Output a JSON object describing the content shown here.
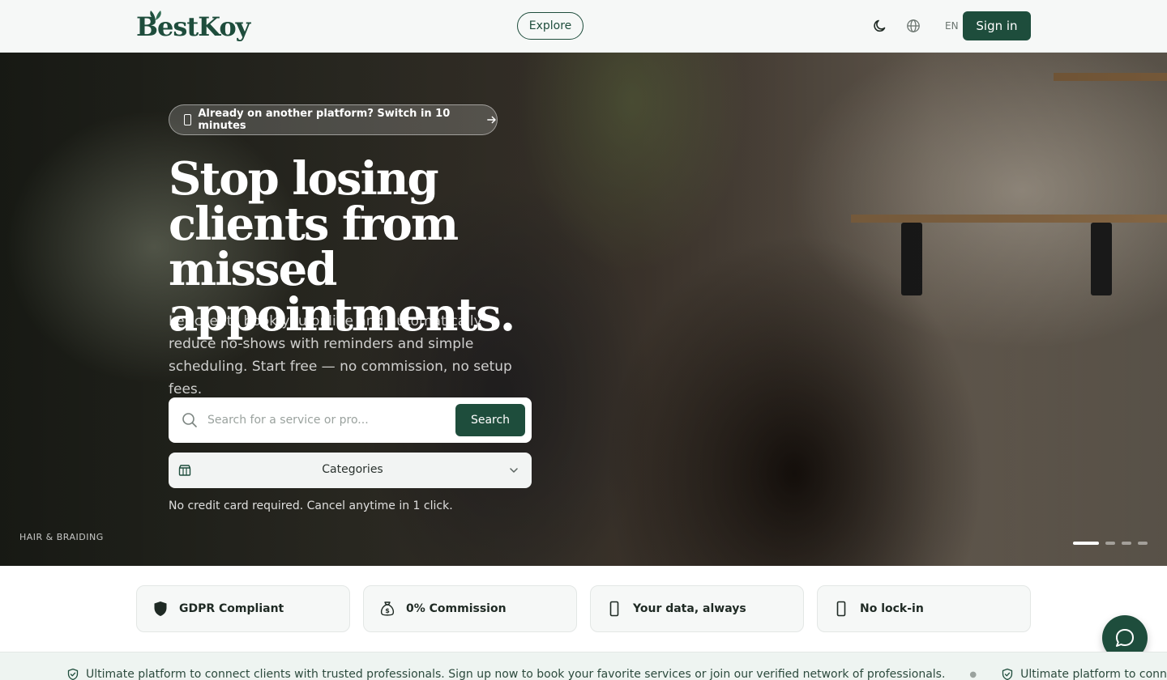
{
  "header": {
    "logo_text": "BestKoy",
    "explore_label": "Explore",
    "lang_label": "  EN",
    "signin_label": "Sign in"
  },
  "hero": {
    "switch_pill": "Already on another platform? Switch in 10 minutes",
    "title": "Stop losing clients from missed appointments.",
    "subtitle": "Let clients book you online and automatically reduce no-shows with reminders and simple scheduling. Start free — no commission, no setup fees.",
    "search_placeholder": "Search for a service or pro...",
    "search_button": "Search",
    "categories_label": "Categories",
    "no_card_text": "No credit card required. Cancel anytime in 1 click.",
    "slide_label": "HAIR & BRAIDING",
    "slides_total": 4,
    "slide_active": 1
  },
  "features": [
    {
      "label": "GDPR Compliant",
      "icon": "shield-icon"
    },
    {
      "label": "0% Commission",
      "icon": "money-bag-icon"
    },
    {
      "label": "Your data, always",
      "icon": "phone-icon"
    },
    {
      "label": "No lock-in",
      "icon": "phone-icon"
    }
  ],
  "ticker": {
    "text": "Ultimate platform to connect clients with trusted professionals. Sign up now to book your favorite services or join our verified network of professionals.",
    "text_repeat": "Ultimate platform to connect clients with trusted professionals. Sign up now to book your favorite services or join our verified network of professionals."
  },
  "colors": {
    "brand": "#1e4d3c",
    "header_bg": "#f6f8f7",
    "ticker_bg": "#eef4f1"
  }
}
